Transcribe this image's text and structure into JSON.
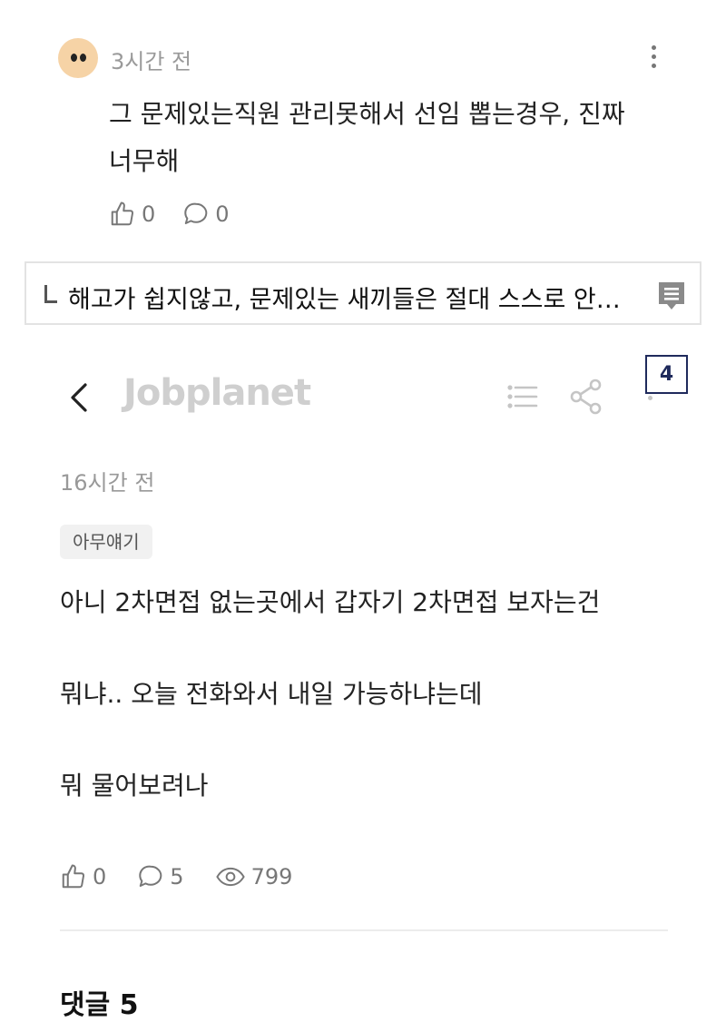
{
  "top_comment": {
    "time": "3시간 전",
    "text_line1": "그 문제있는직원 관리못해서 선임 뽑는경우, 진짜",
    "text_line2": "너무해",
    "likes": "0",
    "replies": "0"
  },
  "reply_preview": {
    "text": "해고가 쉽지않고, 문제있는 새끼들은 절대 스스로 안…"
  },
  "post_header": {
    "brand": "Jobplanet",
    "page_badge": "4"
  },
  "post": {
    "time": "16시간 전",
    "tag": "아무얘기",
    "lines": [
      "아니 2차면접 없는곳에서 갑자기 2차면접 보자는건",
      "뭐냐.. 오늘 전화와서 내일 가능하냐는데",
      "뭐 물어보려나"
    ],
    "likes": "0",
    "comments": "5",
    "views": "799"
  },
  "comments_section": {
    "title": "댓글 5"
  },
  "colors": {
    "avatar_bg": "#f6d3a6",
    "badge_border": "#1f2a5c",
    "brand_gray": "#cfcfcf"
  },
  "icons": [
    "thumbs-up-icon",
    "speech-bubble-icon",
    "eye-icon",
    "chevron-left-icon",
    "list-icon",
    "share-icon",
    "more-vertical-icon",
    "comment-list-icon"
  ]
}
